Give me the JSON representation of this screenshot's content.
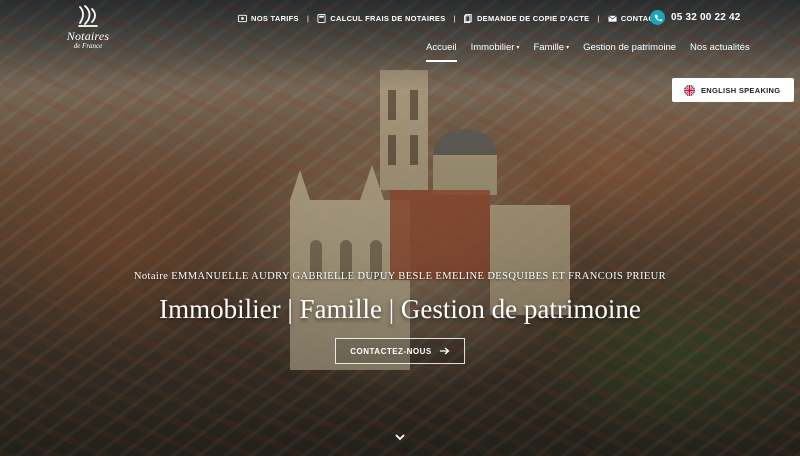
{
  "brand": {
    "line1": "Notaires",
    "line2": "de France"
  },
  "topbar": {
    "items": [
      {
        "label": "NOS TARIFS",
        "icon": "euro-card-icon"
      },
      {
        "label": "CALCUL FRAIS DE NOTAIRES",
        "icon": "calculator-icon"
      },
      {
        "label": "DEMANDE DE COPIE D'ACTE",
        "icon": "document-icon"
      },
      {
        "label": "CONTACT",
        "icon": "mail-icon"
      }
    ],
    "phone": "05 32 00 22 42",
    "phone_icon": "phone-icon"
  },
  "nav": {
    "items": [
      {
        "label": "Accueil",
        "active": true
      },
      {
        "label": "Immobilier",
        "dropdown": true
      },
      {
        "label": "Famille",
        "dropdown": true
      },
      {
        "label": "Gestion de patrimoine"
      },
      {
        "label": "Nos actualités"
      }
    ]
  },
  "language_button": {
    "label": "ENGLISH SPEAKING",
    "icon": "uk-flag-icon"
  },
  "hero": {
    "subtitle": "Notaire EMMANUELLE AUDRY GABRIELLE DUPUY BESLE EMELINE DESQUIBES ET FRANCOIS PRIEUR",
    "headline": "Immobilier | Famille | Gestion de patrimoine",
    "cta_label": "CONTACTEZ-NOUS",
    "cta_icon": "arrow-right-icon",
    "scroll_icon": "chevron-down-icon"
  },
  "colors": {
    "accent": "#1aa6b7",
    "text": "#ffffff"
  }
}
